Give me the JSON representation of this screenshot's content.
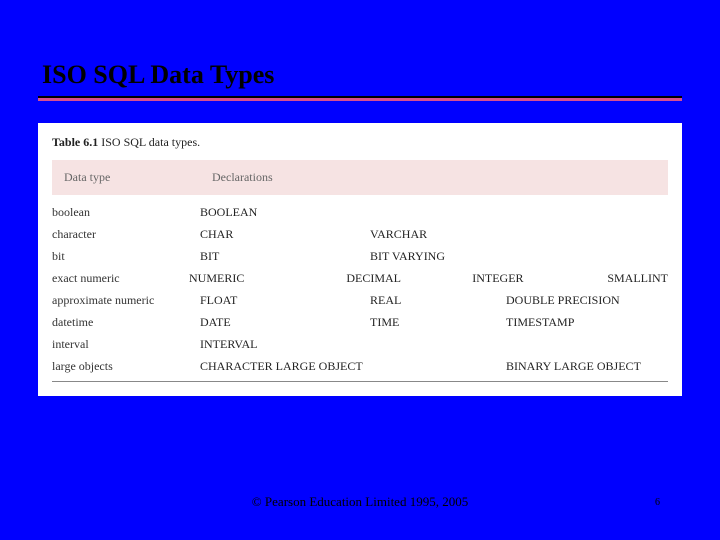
{
  "title": "ISO SQL Data Types",
  "table": {
    "caption_label": "Table 6.1",
    "caption_text": "ISO SQL data types.",
    "header": {
      "col1": "Data type",
      "col2": "Declarations"
    },
    "rows": [
      {
        "c1": "boolean",
        "c2": "BOOLEAN",
        "c3": "",
        "c4": "",
        "c5": ""
      },
      {
        "c1": "character",
        "c2": "CHAR",
        "c3": "VARCHAR",
        "c4": "",
        "c5": ""
      },
      {
        "c1": "bit",
        "c2": "BIT",
        "c3": "BIT VARYING",
        "c4": "",
        "c5": ""
      },
      {
        "c1": "exact numeric",
        "c2": "NUMERIC",
        "c3": "DECIMAL",
        "c4": "INTEGER",
        "c5": "SMALLINT"
      },
      {
        "c1": "approximate numeric",
        "c2": "FLOAT",
        "c3": "REAL",
        "c4": "DOUBLE PRECISION",
        "c5": ""
      },
      {
        "c1": "datetime",
        "c2": "DATE",
        "c3": "TIME",
        "c4": "TIMESTAMP",
        "c5": ""
      },
      {
        "c1": "interval",
        "c2": "INTERVAL",
        "c3": "",
        "c4": "",
        "c5": ""
      },
      {
        "c1": "large objects",
        "c2": "CHARACTER LARGE OBJECT",
        "c3": "",
        "c4": "BINARY LARGE OBJECT",
        "c5": ""
      }
    ]
  },
  "footer": "© Pearson Education Limited 1995, 2005",
  "pagenum": "6"
}
